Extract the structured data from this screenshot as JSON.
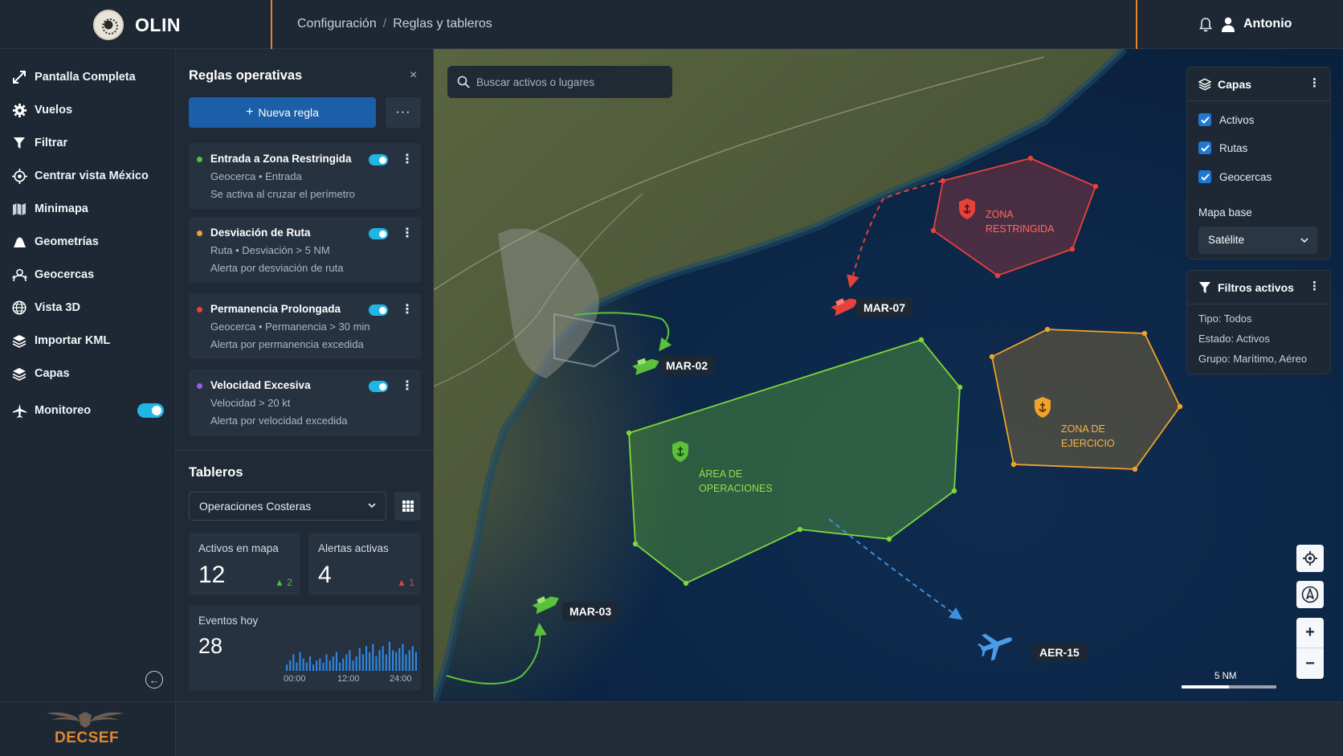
{
  "app": {
    "name": "OLIN",
    "footer_brand": "DECSEF"
  },
  "breadcrumb": {
    "parent": "Configuración",
    "separator": "/",
    "current": "Reglas y tableros"
  },
  "user": {
    "name": "Antonio"
  },
  "nav": {
    "items": [
      {
        "label": "Pantalla Completa",
        "icon": "fullscreen-icon"
      },
      {
        "label": "Vuelos",
        "icon": "gear-icon"
      },
      {
        "label": "Filtrar",
        "icon": "filter-icon"
      },
      {
        "label": "Centrar vista México",
        "icon": "crosshair-icon"
      },
      {
        "label": "Minimapa",
        "icon": "map-icon"
      },
      {
        "label": "Geometrías",
        "icon": "geometry-icon"
      },
      {
        "label": "Geocercas",
        "icon": "geofence-icon"
      },
      {
        "label": "Vista 3D",
        "icon": "globe-icon"
      },
      {
        "label": "Importar KML",
        "icon": "stack-icon"
      },
      {
        "label": "Capas",
        "icon": "layers-icon"
      },
      {
        "label": "Monitoreo",
        "icon": "plane-icon",
        "toggle": true
      }
    ]
  },
  "rules": {
    "title": "Reglas operativas",
    "close": "×",
    "new_button": "Nueva regla",
    "more": "···",
    "items": [
      {
        "name": "Entrada a Zona Restringida",
        "meta": "Geocerca • Entrada",
        "desc": "Se activa al cruzar el perímetro",
        "color": "#4cc23a",
        "enabled": true
      },
      {
        "name": "Desviación de Ruta",
        "meta": "Ruta • Desviación > 5 NM",
        "desc": "Alerta por desviación de ruta",
        "color": "#f0a32a",
        "enabled": true
      },
      {
        "name": "Permanencia Prolongada",
        "meta": "Geocerca • Permanencia > 30 min",
        "desc": "Alerta por permanencia excedida",
        "color": "#e8413b",
        "enabled": true
      },
      {
        "name": "Velocidad Excesiva",
        "meta": "Velocidad > 20 kt",
        "desc": "Alerta por velocidad excedida",
        "color": "#9b5de5",
        "enabled": true
      }
    ]
  },
  "boards": {
    "title": "Tableros",
    "selected": "Operaciones Costeras",
    "stats": {
      "assets": {
        "label": "Activos en mapa",
        "value": "12",
        "delta": "▲ 2",
        "delta_color": "#4cc23a"
      },
      "alerts": {
        "label": "Alertas activas",
        "value": "4",
        "delta": "▲ 1",
        "delta_color": "#e8413b"
      },
      "events": {
        "label": "Eventos hoy",
        "value": "28",
        "axis": [
          "00:00",
          "12:00",
          "24:00"
        ],
        "bars": [
          3,
          5,
          8,
          4,
          9,
          6,
          4,
          7,
          3,
          5,
          6,
          4,
          8,
          5,
          7,
          9,
          4,
          6,
          8,
          10,
          5,
          7,
          11,
          8,
          12,
          9,
          13,
          7,
          10,
          12,
          8,
          14,
          10,
          9,
          11,
          13,
          8,
          10,
          12,
          9
        ]
      }
    }
  },
  "map": {
    "search_placeholder": "Buscar activos o lugares",
    "zones": {
      "restricted": {
        "line1": "ZONA",
        "line2": "RESTRINGIDA",
        "color": "#e8413b"
      },
      "operations": {
        "line1": "ÁREA DE",
        "line2": "OPERACIONES",
        "color": "#7ed63a"
      },
      "exercise": {
        "line1": "ZONA DE",
        "line2": "EJERCICIO",
        "color": "#f0a32a"
      }
    },
    "assets": [
      {
        "id": "MAR-07",
        "color": "#e8413b"
      },
      {
        "id": "MAR-02",
        "color": "#59c23a"
      },
      {
        "id": "MAR-03",
        "color": "#59c23a"
      },
      {
        "id": "AER-15",
        "color": "#3d8fe0"
      }
    ],
    "scale": "5 NM"
  },
  "layers": {
    "title": "Capas",
    "items": [
      {
        "label": "Activos",
        "checked": true
      },
      {
        "label": "Rutas",
        "checked": true
      },
      {
        "label": "Geocercas",
        "checked": true
      }
    ],
    "base_label": "Mapa base",
    "base_value": "Satélite"
  },
  "filters": {
    "title": "Filtros activos",
    "lines": [
      "Tipo: Todos",
      "Estado: Activos",
      "Grupo: Marítimo, Aéreo"
    ]
  },
  "colors": {
    "accent": "#e0872e",
    "primary": "#1b5fa8",
    "toggle": "#1fb6e6"
  }
}
